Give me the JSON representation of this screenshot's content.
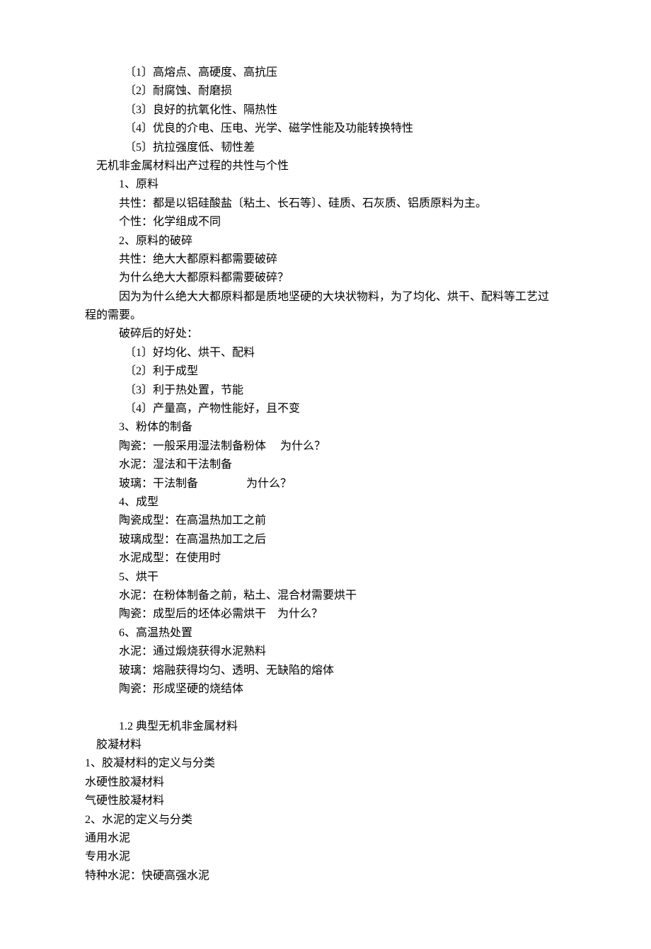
{
  "lines": [
    {
      "indent": 4,
      "text": "〔1〕高熔点、高硬度、高抗压"
    },
    {
      "indent": 4,
      "text": "〔2〕耐腐蚀、耐磨损"
    },
    {
      "indent": 4,
      "text": "〔3〕良好的抗氧化性、隔热性"
    },
    {
      "indent": 4,
      "text": "〔4〕优良的介电、压电、光学、磁学性能及功能转换特性"
    },
    {
      "indent": 4,
      "text": "〔5〕抗拉强度低、韧性差"
    },
    {
      "indent": 1,
      "text": "无机非金属材料出产过程的共性与个性"
    },
    {
      "indent": 3,
      "text": "1、原料"
    },
    {
      "indent": 3,
      "text": "共性：都是以铝硅酸盐〔粘土、长石等〕、硅质、石灰质、铝质原料为主。"
    },
    {
      "indent": 3,
      "text": "个性：化学组成不同"
    },
    {
      "indent": 3,
      "text": "2、原料的破碎"
    },
    {
      "indent": 3,
      "text": "共性：绝大大都原料都需要破碎"
    },
    {
      "indent": 3,
      "text": "为什么绝大大都原料都需要破碎？"
    },
    {
      "indent": 3,
      "text": "因为为什么绝大大都原料都是质地坚硬的大块状物料，为了均化、烘干、配料等工艺过"
    },
    {
      "indent": 0,
      "text": "程的需要。"
    },
    {
      "indent": 3,
      "text": "破碎后的好处："
    },
    {
      "indent": 4,
      "text": "〔1〕好均化、烘干、配料"
    },
    {
      "indent": 4,
      "text": "〔2〕利于成型"
    },
    {
      "indent": 4,
      "text": "〔3〕利于热处置，节能"
    },
    {
      "indent": 4,
      "text": "〔4〕产量高，产物性能好，且不变"
    },
    {
      "indent": 3,
      "text": "3、粉体的制备"
    },
    {
      "indent": 3,
      "text": "陶瓷：一般采用湿法制备粉体     为什么？"
    },
    {
      "indent": 3,
      "text": "水泥：湿法和干法制备"
    },
    {
      "indent": 3,
      "text": "玻璃：干法制备                 为什么？"
    },
    {
      "indent": 3,
      "text": "4、成型"
    },
    {
      "indent": 3,
      "text": "陶瓷成型：在高温热加工之前"
    },
    {
      "indent": 3,
      "text": "玻璃成型：在高温热加工之后"
    },
    {
      "indent": 3,
      "text": "水泥成型：在使用时"
    },
    {
      "indent": 3,
      "text": "5、烘干"
    },
    {
      "indent": 3,
      "text": "水泥：在粉体制备之前，粘土、混合材需要烘干"
    },
    {
      "indent": 3,
      "text": "陶瓷：成型后的坯体必需烘干    为什么？"
    },
    {
      "indent": 3,
      "text": "6、高温热处置"
    },
    {
      "indent": 3,
      "text": "水泥：通过煅烧获得水泥熟料"
    },
    {
      "indent": 3,
      "text": "玻璃：熔融获得均匀、透明、无缺陷的熔体"
    },
    {
      "indent": 3,
      "text": "陶瓷：形成坚硬的烧结体"
    },
    {
      "indent": 3,
      "text": ""
    },
    {
      "indent": 3,
      "text": "1.2 典型无机非金属材料"
    },
    {
      "indent": 1,
      "text": "胶凝材料"
    },
    {
      "indent": 0,
      "text": "1、胶凝材料的定义与分类"
    },
    {
      "indent": 0,
      "text": "水硬性胶凝材料"
    },
    {
      "indent": 0,
      "text": "气硬性胶凝材料"
    },
    {
      "indent": 0,
      "text": "2、水泥的定义与分类"
    },
    {
      "indent": 0,
      "text": "通用水泥"
    },
    {
      "indent": 0,
      "text": "专用水泥"
    },
    {
      "indent": 0,
      "text": "特种水泥：快硬高强水泥"
    }
  ]
}
